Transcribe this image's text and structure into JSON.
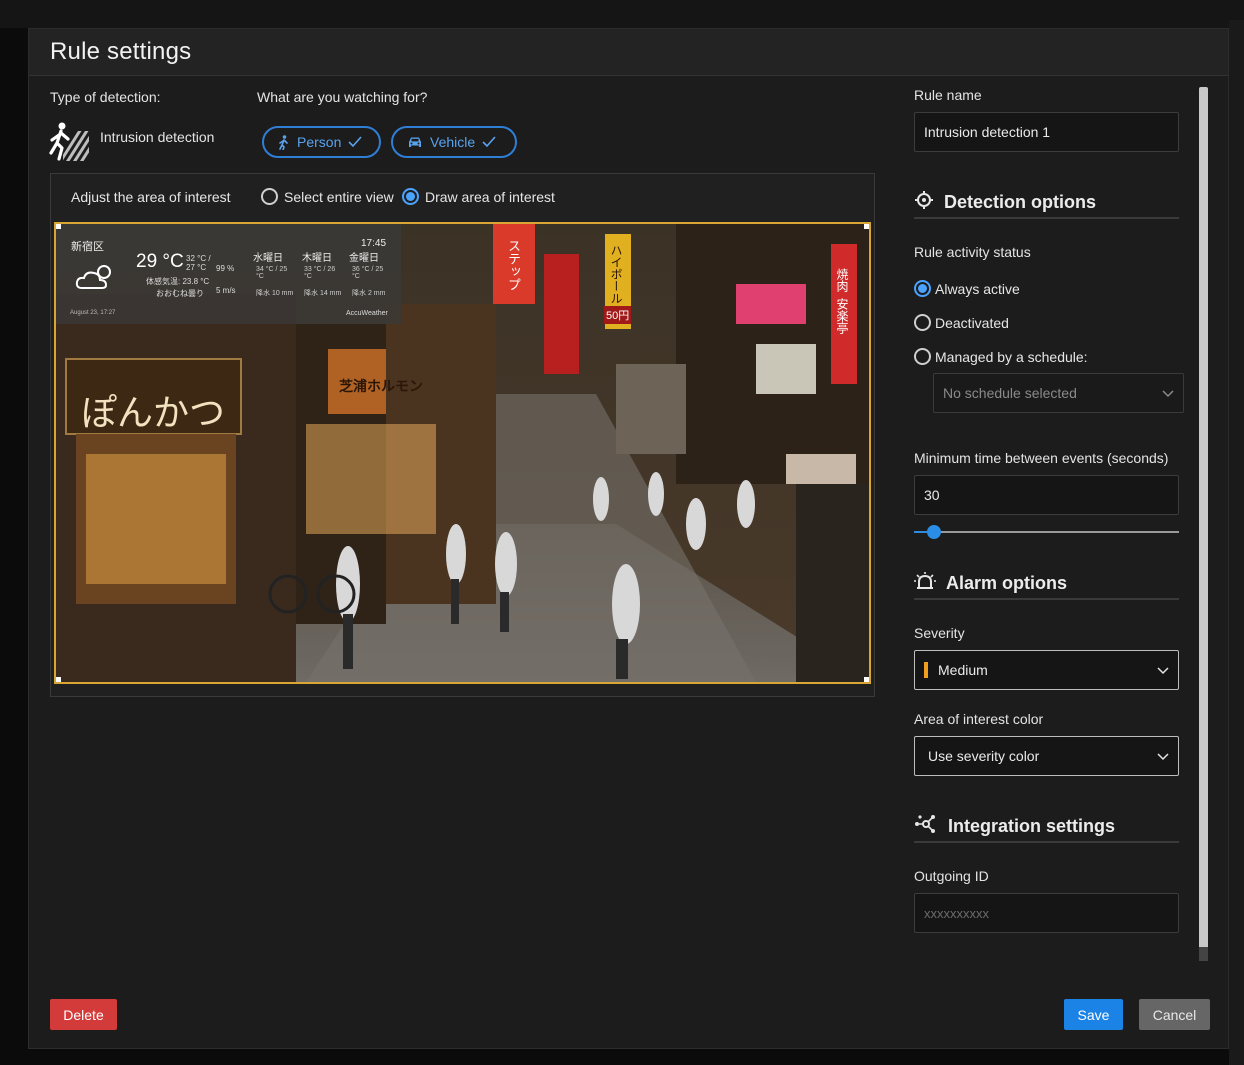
{
  "modal": {
    "title": "Rule settings"
  },
  "detection": {
    "type_label": "Type of detection:",
    "type_value": "Intrusion detection",
    "type_icon": "intrusion-runner-icon",
    "watch_label": "What are you watching for?",
    "targets": [
      {
        "label": "Person",
        "icon": "person-walking-icon",
        "selected": true
      },
      {
        "label": "Vehicle",
        "icon": "car-icon",
        "selected": true
      }
    ]
  },
  "aoi": {
    "label": "Adjust the area of interest",
    "options": [
      {
        "label": "Select entire view",
        "checked": false
      },
      {
        "label": "Draw area of interest",
        "checked": true
      }
    ]
  },
  "camera": {
    "overlay": {
      "location": "新宿区",
      "temp": "29 °C",
      "hi_lo": "32 °C / 27 °C",
      "humidity": "99 %",
      "wind": "5 m/s",
      "feels_like": "体感気温: 23.8 °C",
      "condition": "おおむね曇り",
      "time": "17:45",
      "days": [
        {
          "day": "水曜日",
          "temp": "34 °C / 25 °C",
          "rain": "降水 10 mm"
        },
        {
          "day": "木曜日",
          "temp": "33 °C / 26 °C",
          "rain": "降水 14 mm"
        },
        {
          "day": "金曜日",
          "temp": "36 °C / 25 °C",
          "rain": "降水 2 mm"
        }
      ],
      "brand": "AccuWeather",
      "updated": "August 23, 17:27"
    },
    "signs": {
      "left_sign": "ぽんかつ",
      "center_sign": "芝浦ホルモン",
      "vertical_1": "ステップ",
      "vertical_2": "ハイボール",
      "vertical_3": "焼肉",
      "vertical_4": "安楽亭",
      "price": "50円"
    },
    "aoi_color": "#d9a634"
  },
  "rule": {
    "name_label": "Rule name",
    "name_value": "Intrusion detection 1"
  },
  "detection_options": {
    "title": "Detection options",
    "icon": "target-icon",
    "status_label": "Rule activity status",
    "status_options": [
      {
        "label": "Always active",
        "checked": true
      },
      {
        "label": "Deactivated",
        "checked": false
      },
      {
        "label": "Managed by a schedule:",
        "checked": false
      }
    ],
    "schedule_placeholder": "No schedule selected",
    "min_time_label": "Minimum time between events (seconds)",
    "min_time_value": "30",
    "slider_fraction": 0.05
  },
  "alarm_options": {
    "title": "Alarm options",
    "icon": "alarm-bell-icon",
    "severity_label": "Severity",
    "severity_value": "Medium",
    "severity_color": "#f0a01e",
    "aoi_color_label": "Area of interest color",
    "aoi_color_value": "Use severity color"
  },
  "integration": {
    "title": "Integration settings",
    "icon": "integration-nodes-icon",
    "outgoing_label": "Outgoing ID",
    "outgoing_placeholder": "xxxxxxxxxx"
  },
  "actions": {
    "delete": "Delete",
    "save": "Save",
    "cancel": "Cancel"
  },
  "colors": {
    "accent": "#1b82e6",
    "danger": "#d33a3a",
    "background": "#1c1c1c"
  }
}
